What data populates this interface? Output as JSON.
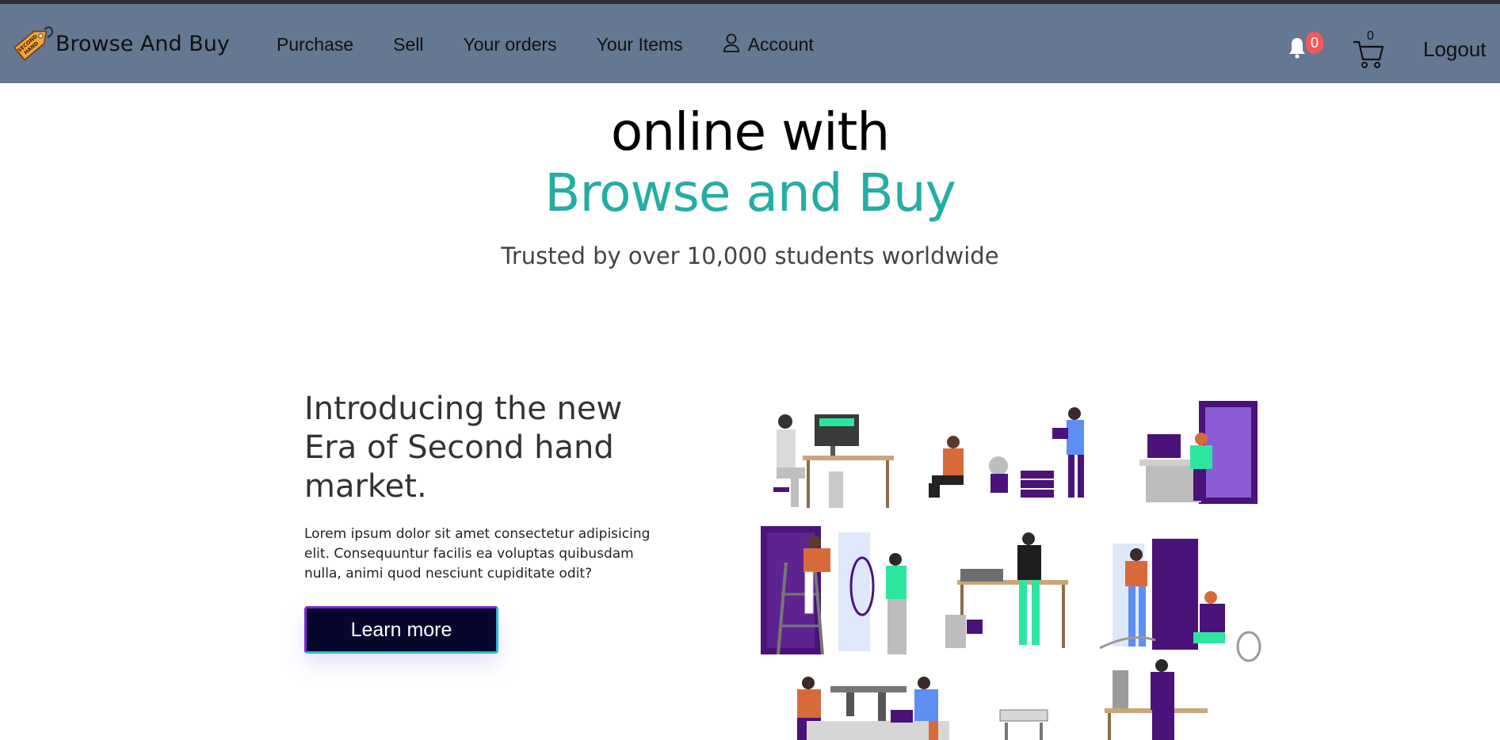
{
  "navbar": {
    "brand_name": "Browse And Buy",
    "logo_text_top": "SECOND",
    "logo_text_bottom": "HAND",
    "links": {
      "purchase": "Purchase",
      "sell": "Sell",
      "your_orders": "Your orders",
      "your_items": "Your Items",
      "account": "Account"
    },
    "notification_count": "0",
    "cart_count": "0",
    "logout": "Logout"
  },
  "hero": {
    "line1": "online with",
    "line2": "Browse and Buy",
    "subtitle": "Trusted by over 10,000 students worldwide"
  },
  "intro": {
    "title": "Introducing the new Era of Second hand market.",
    "body": "Lorem ipsum dolor sit amet consectetur adipisicing elit. Consequuntur facilis ea voluptas quibusdam nulla, animi quod nesciunt cupiditate odit?",
    "button_label": "Learn more"
  },
  "colors": {
    "navbar": "#667791",
    "accent_teal": "#24ada5",
    "button_bg": "#08062c",
    "badge": "#f05a5a",
    "illustration_purple": "#4b137a",
    "illustration_orange": "#d86a3a",
    "illustration_green": "#2ce6a0",
    "illustration_blue": "#5d8ef2"
  }
}
